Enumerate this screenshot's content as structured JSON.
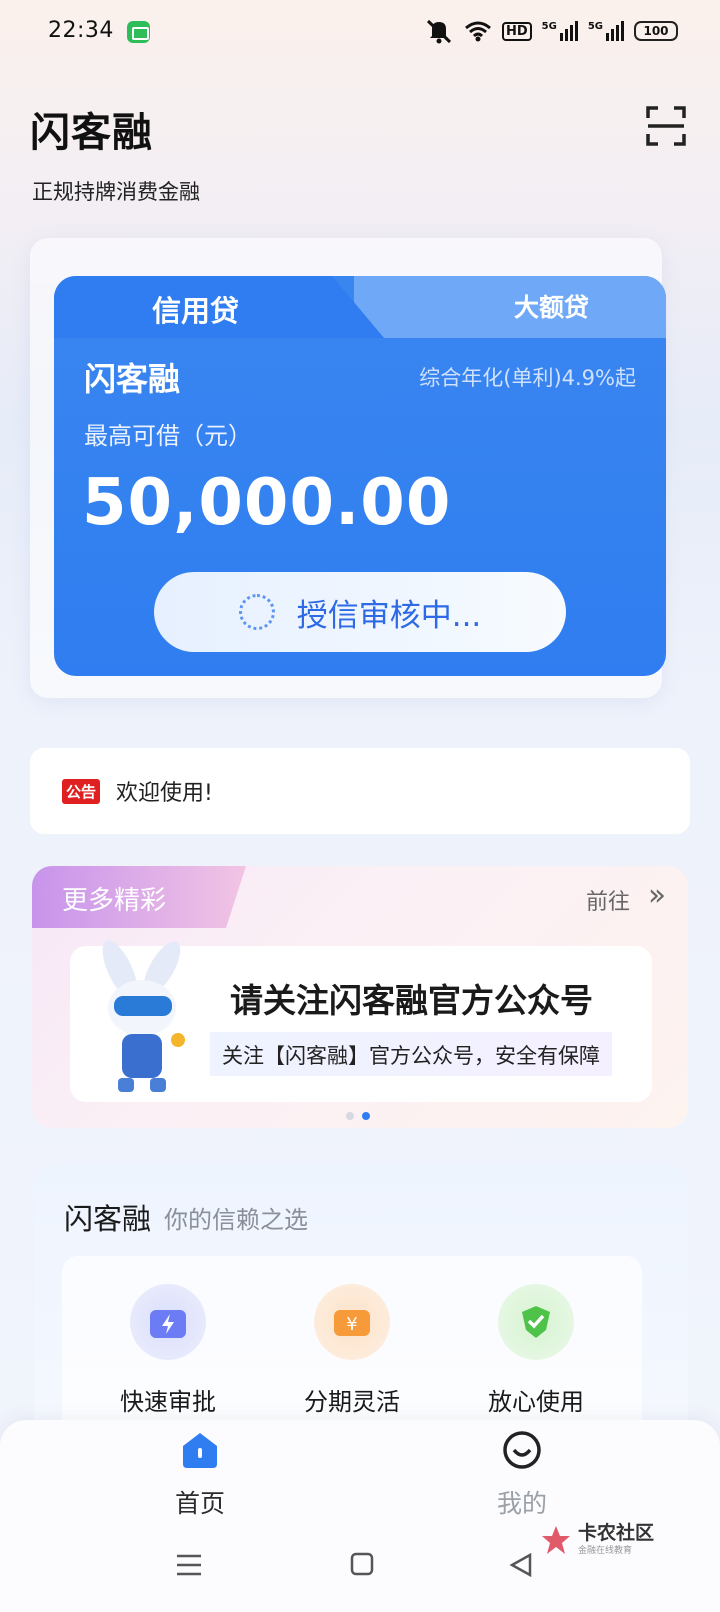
{
  "status_bar": {
    "time": "22:34",
    "network": "HD",
    "signal1_label": "5G",
    "signal2_label": "5G",
    "battery": "100"
  },
  "header": {
    "brand": "闪客融",
    "subtitle": "正规持牌消费金融"
  },
  "loan_card": {
    "tabs": [
      "信用贷",
      "大额贷"
    ],
    "active_tab": "信用贷",
    "product_name": "闪客融",
    "rate_text": "综合年化(单利)4.9%起",
    "max_label": "最高可借（元）",
    "amount": "50,000.00",
    "status_text": "授信审核中..."
  },
  "notice": {
    "badge": "公告",
    "text": "欢迎使用!"
  },
  "more": {
    "title": "更多精彩",
    "go_label": "前往",
    "banner_title": "请关注闪客融官方公众号",
    "banner_subtitle": "关注【闪客融】官方公众号，安全有保障",
    "page_count": 2,
    "active_page": 2
  },
  "features": {
    "brand": "闪客融",
    "slogan": "你的信赖之选",
    "items": [
      {
        "label": "快速审批",
        "icon": "lightning-icon",
        "color": "#6b7cf5"
      },
      {
        "label": "分期灵活",
        "icon": "yen-icon",
        "color": "#f79a3a"
      },
      {
        "label": "放心使用",
        "icon": "check-shield-icon",
        "color": "#4fc24a"
      }
    ]
  },
  "tabbar": {
    "items": [
      {
        "label": "首页",
        "icon": "home-icon",
        "active": true
      },
      {
        "label": "我的",
        "icon": "smile-icon",
        "active": false
      }
    ],
    "active_color": "#2f7df0"
  },
  "watermark": {
    "title": "卡农社区",
    "subtitle": "金融在线教育"
  }
}
